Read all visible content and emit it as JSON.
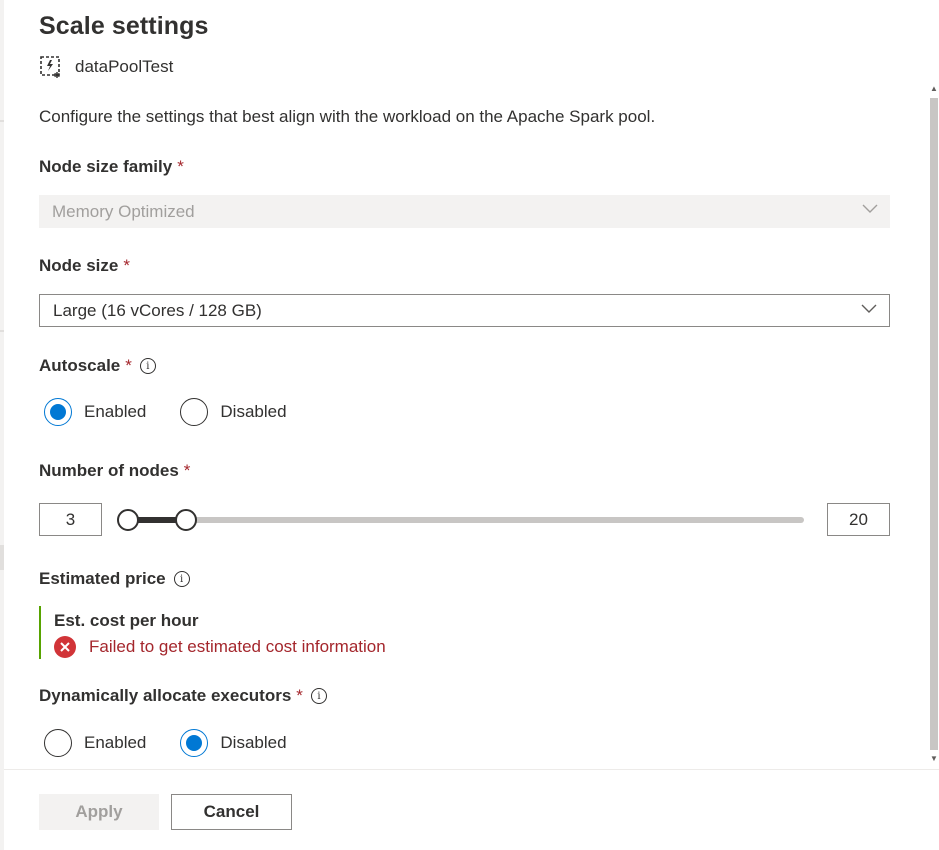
{
  "panel": {
    "title": "Scale settings",
    "pool_name": "dataPoolTest",
    "description": "Configure the settings that best align with the workload on the Apache Spark pool."
  },
  "node_size_family": {
    "label": "Node size family",
    "required_mark": "*",
    "value": "Memory Optimized",
    "disabled": true
  },
  "node_size": {
    "label": "Node size",
    "required_mark": "*",
    "value": "Large (16 vCores / 128 GB)"
  },
  "autoscale": {
    "label": "Autoscale",
    "required_mark": "*",
    "info_icon": "info-icon",
    "options": [
      "Enabled",
      "Disabled"
    ],
    "selected": "Enabled"
  },
  "nodes": {
    "label": "Number of nodes",
    "required_mark": "*",
    "min_value": "3",
    "max_value": "20"
  },
  "estimated_price": {
    "label": "Estimated price",
    "info_icon": "info-icon",
    "cost_title": "Est. cost per hour",
    "error_text": "Failed to get estimated cost information"
  },
  "dynamic_executors": {
    "label": "Dynamically allocate executors",
    "required_mark": "*",
    "info_icon": "info-icon",
    "options": [
      "Enabled",
      "Disabled"
    ],
    "selected": "Disabled"
  },
  "footer": {
    "apply_label": "Apply",
    "cancel_label": "Cancel"
  },
  "colors": {
    "accent": "#0078d4",
    "required": "#a4262c",
    "error": "#d13438",
    "success_bar": "#57a300"
  }
}
